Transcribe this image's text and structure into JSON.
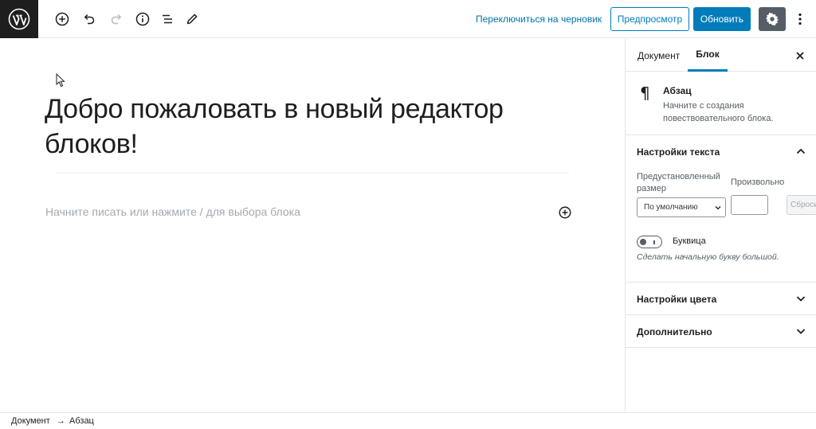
{
  "toolbar": {
    "switch_to_draft": "Переключиться на черновик",
    "preview_label": "Предпросмотр",
    "update_label": "Обновить"
  },
  "editor": {
    "title": "Добро пожаловать в новый редактор блоков!",
    "placeholder": "Начните писать или нажмите / для выбора блока"
  },
  "sidebar": {
    "tabs": [
      {
        "label": "Документ",
        "active": false
      },
      {
        "label": "Блок",
        "active": true
      }
    ],
    "block": {
      "name": "Абзац",
      "description": "Начните с создания повествовательного блока."
    },
    "text_settings": {
      "title": "Настройки текста",
      "preset_label": "Предустановленный размер",
      "preset_value": "По умолчанию",
      "custom_label": "Произвольно",
      "reset_label": "Сбросить",
      "dropcap_label": "Буквица",
      "dropcap_help": "Сделать начальную букву большой."
    },
    "color_settings": {
      "title": "Настройки цвета"
    },
    "advanced": {
      "title": "Дополнительно"
    }
  },
  "footer": {
    "breadcrumb": [
      "Документ",
      "→",
      "Абзац"
    ]
  },
  "colors": {
    "accent": "#007cba",
    "dark": "#1e1e1e",
    "settings_bg": "#555d66"
  }
}
